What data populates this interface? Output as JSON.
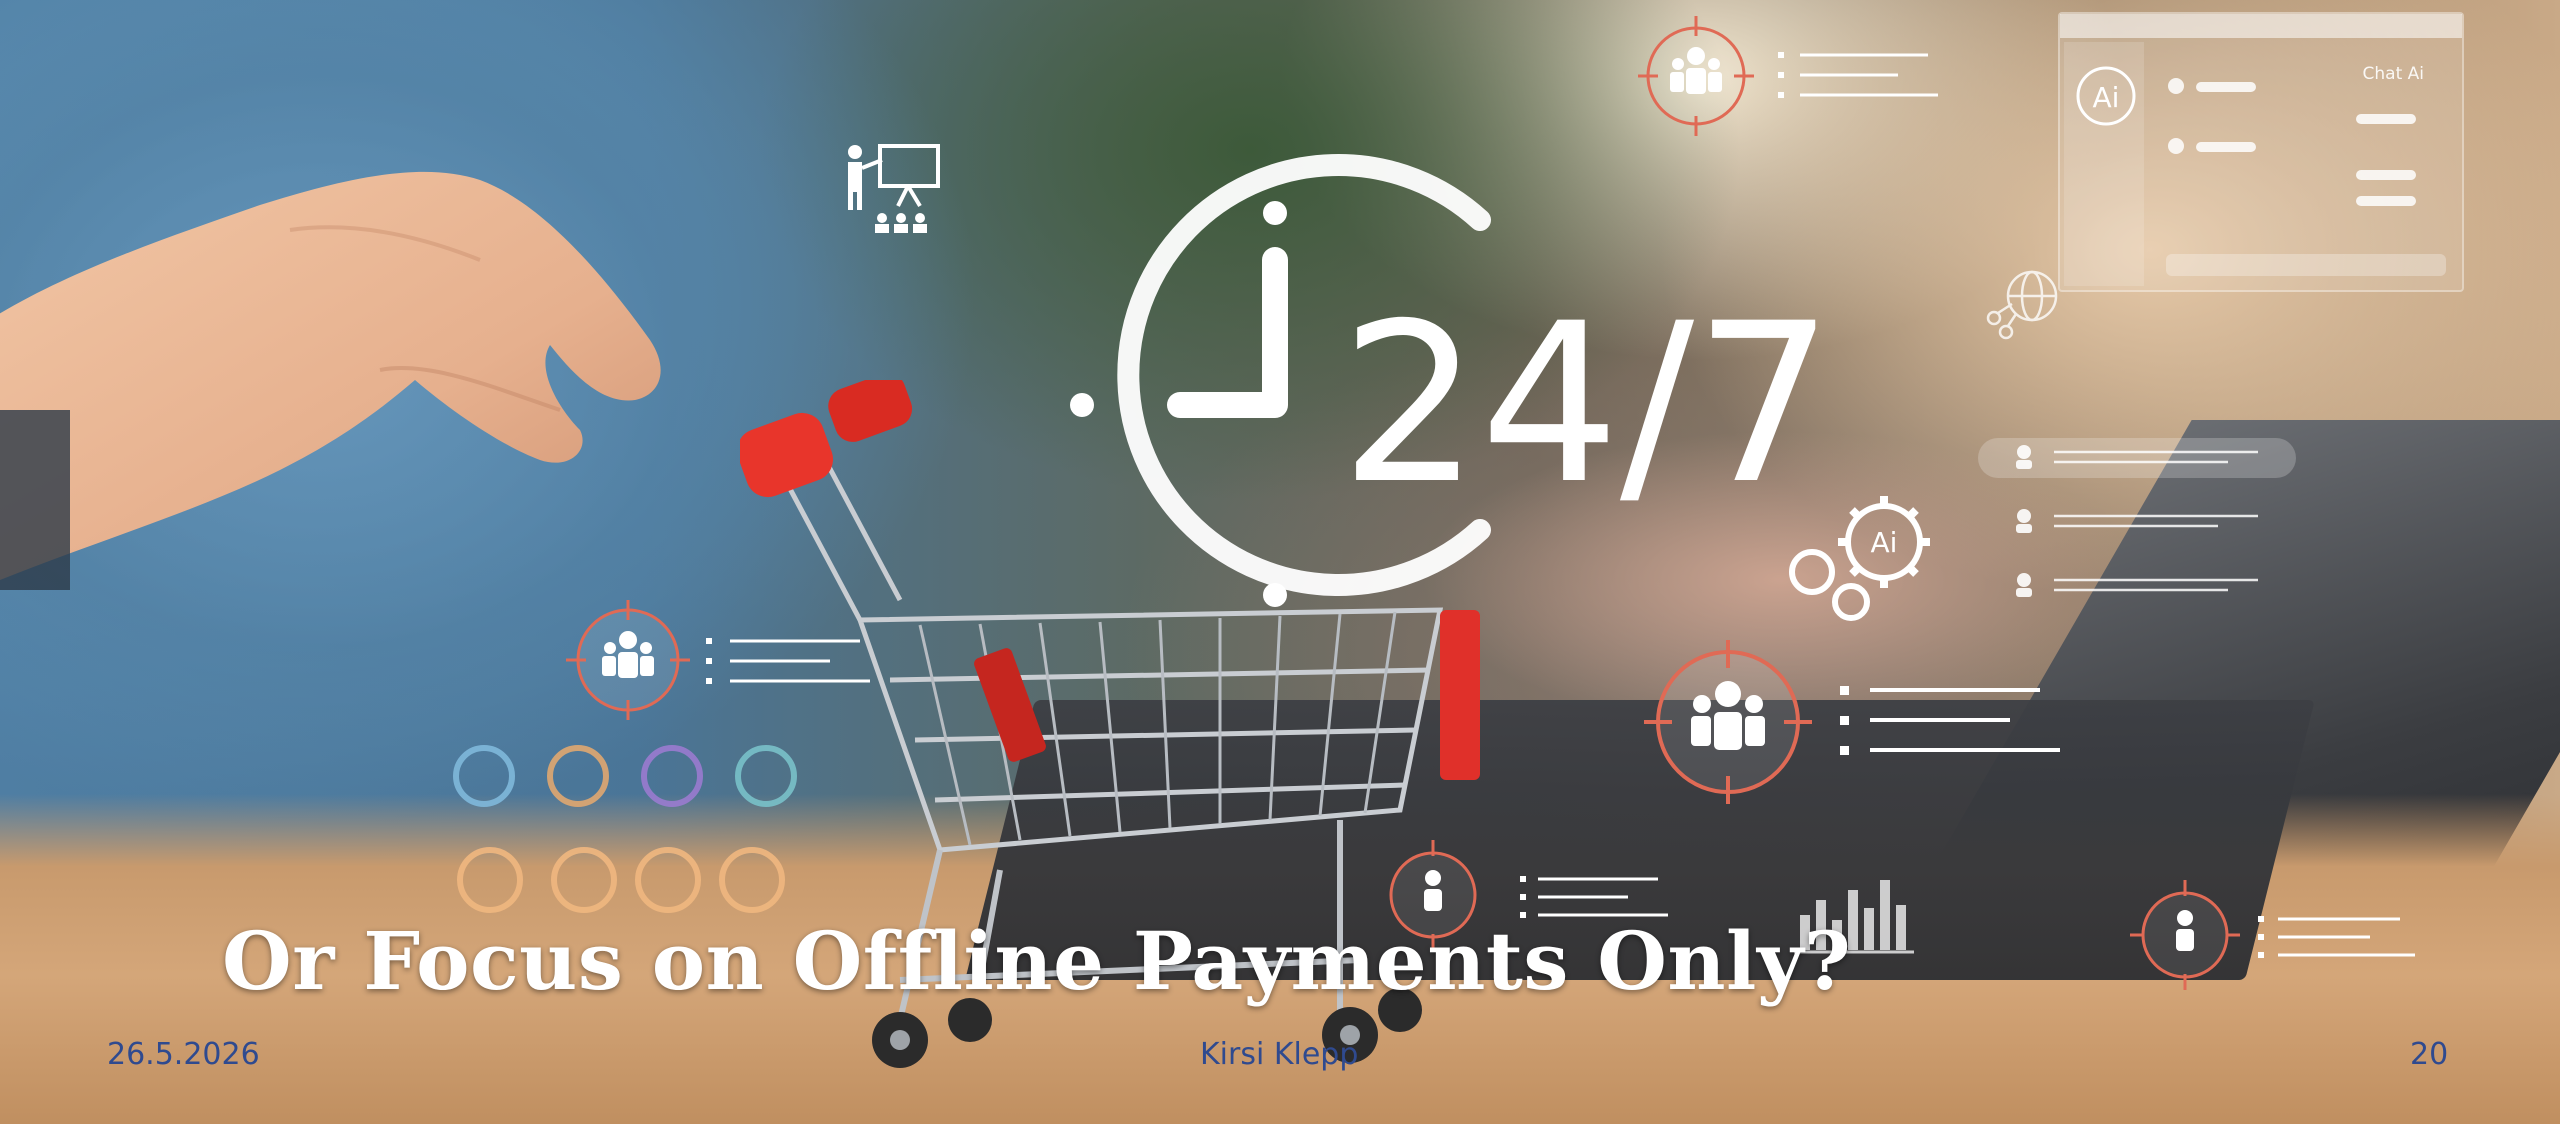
{
  "slide": {
    "title": "Or Focus on Offline Payments Only?",
    "footer": {
      "date": "26.5.2026",
      "author": "Kirsi Klepp",
      "page_number": "20"
    }
  },
  "graphics": {
    "clock_text": "24/7",
    "chat_panel_title": "Chat Ai",
    "ai_badge": "Ai",
    "gear_badge": "Ai"
  },
  "colors": {
    "title": "#ffffff",
    "footer": "#2f4a8f",
    "cart_red": "#e8352b",
    "overlay_white": "#ffffff",
    "target_red": "#e06a55"
  }
}
